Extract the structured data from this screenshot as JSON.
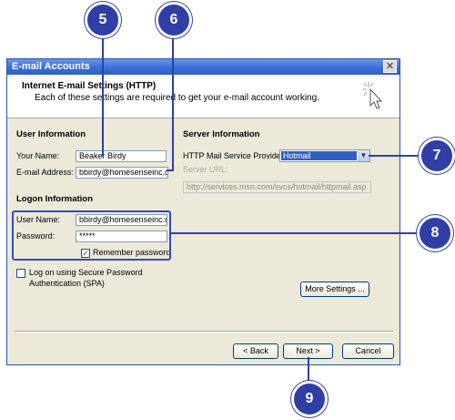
{
  "window": {
    "title": "E-mail Accounts",
    "close_icon": "close-icon"
  },
  "header": {
    "title": "Internet E-mail Settings (HTTP)",
    "subtitle": "Each of these settings are required to get your e-mail account working.",
    "icon": "wizard-cursor-icon"
  },
  "user_info": {
    "heading": "User Information",
    "your_name_label": "Your Name:",
    "your_name_value": "Beaker Birdy",
    "email_label": "E-mail Address:",
    "email_value": "bbirdy@homesenseinc.com"
  },
  "server_info": {
    "heading": "Server Information",
    "provider_label": "HTTP Mail Service Provider:",
    "provider_value": "Hotmail",
    "url_label": "Server URL:",
    "url_value": "http://services.msn.com/svcs/hotmail/httpmail.asp"
  },
  "logon_info": {
    "heading": "Logon Information",
    "username_label": "User Name:",
    "username_value": "bbirdy@homesenseinc.com",
    "password_label": "Password:",
    "password_value": "*****",
    "remember_label": "Remember password",
    "remember_checked": true
  },
  "spa": {
    "label_line1": "Log on using Secure Password",
    "label_line2": "Authentication (SPA)",
    "checked": false
  },
  "buttons": {
    "more_settings": "More Settings ...",
    "back": "< Back",
    "next": "Next >",
    "cancel": "Cancel"
  },
  "callouts": {
    "c5": "5",
    "c6": "6",
    "c7": "7",
    "c8": "8",
    "c9": "9"
  },
  "colors": {
    "callout": "#2f3fa6",
    "titlebar": "#3a6ed6",
    "dialog_bg": "#ece9d8"
  }
}
